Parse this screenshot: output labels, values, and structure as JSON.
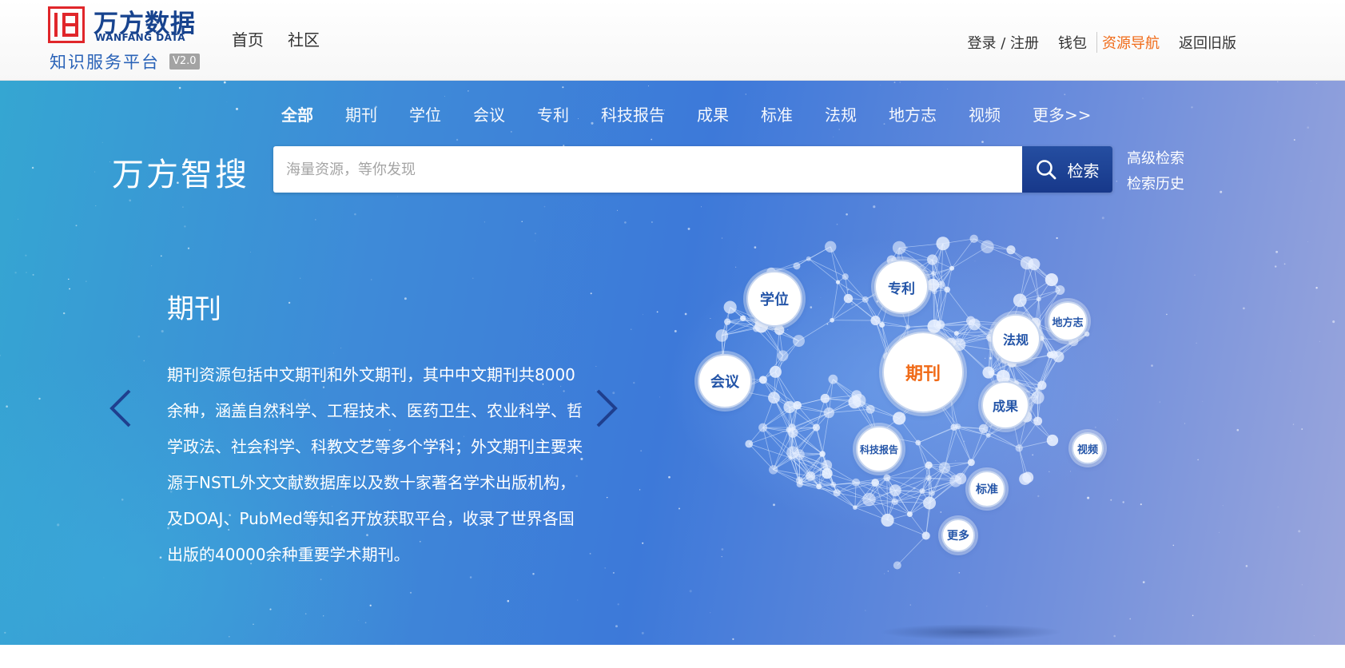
{
  "header": {
    "logo": {
      "cn": "万方数据",
      "en": "WANFANG DATA",
      "subtitle": "知识服务平台",
      "version": "V2.0"
    },
    "main_nav": [
      {
        "label": "首页"
      },
      {
        "label": "社区"
      }
    ],
    "user_nav": {
      "login": "登录 / 注册",
      "wallet": "钱包",
      "resource_nav": "资源导航",
      "old_version": "返回旧版"
    },
    "accent_color": "#f06a17",
    "brand_color": "#17438e"
  },
  "banner": {
    "tabs": [
      {
        "label": "全部",
        "active": true
      },
      {
        "label": "期刊"
      },
      {
        "label": "学位"
      },
      {
        "label": "会议"
      },
      {
        "label": "专利"
      },
      {
        "label": "科技报告"
      },
      {
        "label": "成果"
      },
      {
        "label": "标准"
      },
      {
        "label": "法规"
      },
      {
        "label": "地方志"
      },
      {
        "label": "视频"
      },
      {
        "label": "更多>>"
      }
    ],
    "search": {
      "brand": "万方智搜",
      "placeholder": "海量资源，等你发现",
      "value": "",
      "button_label": "检索",
      "advanced_label": "高级检索",
      "history_label": "检索历史"
    },
    "slide": {
      "title": "期刊",
      "description": "期刊资源包括中文期刊和外文期刊，其中中文期刊共8000余种，涵盖自然科学、工程技术、医药卫生、农业科学、哲学政法、社会科学、科教文艺等多个学科；外文期刊主要来源于NSTL外文文献数据库以及数十家著名学术出版机构，及DOAJ、PubMed等知名开放获取平台，收录了世界各国出版的40000余种重要学术期刊。"
    },
    "brain_bubbles": {
      "main": "期刊",
      "degree": "学位",
      "patent": "专利",
      "regional": "地方志",
      "law": "法规",
      "conference": "会议",
      "result": "成果",
      "report": "科技报告",
      "video": "视频",
      "standard": "标准",
      "more": "更多"
    },
    "icons": {
      "search": "search-icon",
      "prev": "chevron-left-icon",
      "next": "chevron-right-icon"
    }
  }
}
